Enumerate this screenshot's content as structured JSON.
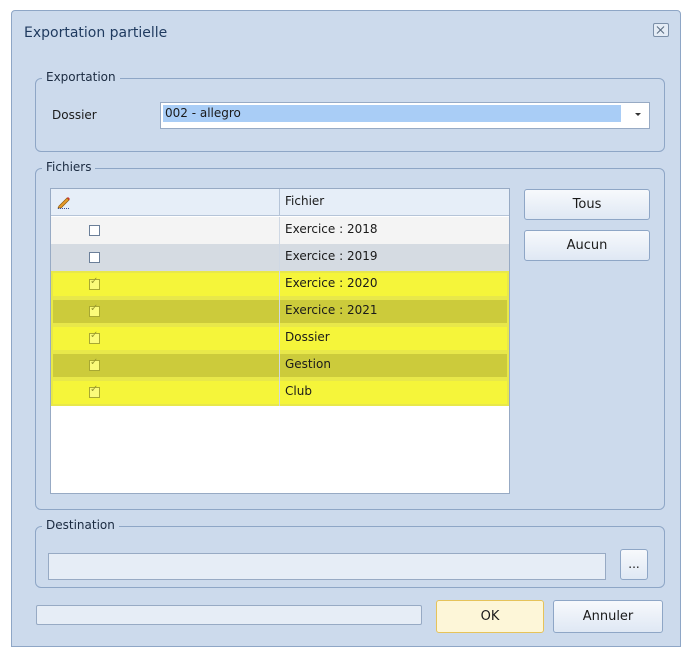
{
  "window": {
    "title": "Exportation partielle"
  },
  "export_group": {
    "legend": "Exportation",
    "dossier_label": "Dossier",
    "dossier_value": "002 - allegro"
  },
  "files_group": {
    "legend": "Fichiers",
    "column_header": "Fichier",
    "rows": [
      {
        "label": "Exercice : 2018",
        "checked": false,
        "bg": "#f4f4f4"
      },
      {
        "label": "Exercice : 2019",
        "checked": false,
        "bg": "#d5dbe2"
      },
      {
        "label": "Exercice : 2020",
        "checked": true,
        "bg": "#f5f53a"
      },
      {
        "label": "Exercice : 2021",
        "checked": true,
        "bg": "#cccb3b"
      },
      {
        "label": "Dossier",
        "checked": true,
        "bg": "#f5f53a"
      },
      {
        "label": "Gestion",
        "checked": true,
        "bg": "#cccb3b"
      },
      {
        "label": "Club",
        "checked": true,
        "bg": "#f5f53a"
      }
    ],
    "btn_all": "Tous",
    "btn_none": "Aucun"
  },
  "destination_group": {
    "legend": "Destination",
    "path_value": "",
    "browse_label": "..."
  },
  "footer": {
    "progress": 0,
    "ok_label": "OK",
    "cancel_label": "Annuler"
  },
  "icons": {
    "close": "close-icon",
    "dropdown": "chevron-down-icon",
    "edit": "pencil-icon"
  }
}
